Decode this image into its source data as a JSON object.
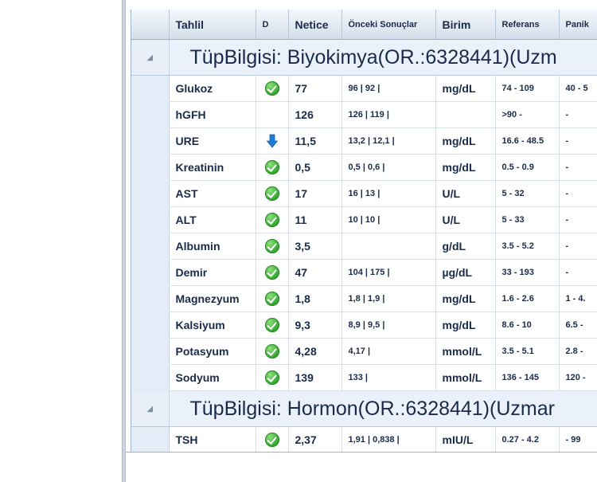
{
  "columns": {
    "tahlil": "Tahlil",
    "d": "D",
    "netice": "Netice",
    "onceki": "Önceki Sonuçlar",
    "birim": "Birim",
    "referans": "Referans",
    "panik": "Panik"
  },
  "groups": [
    {
      "title": "TüpBilgisi: Biyokimya(OR.:6328441)(Uzm",
      "rows": [
        {
          "name": "Glukoz",
          "status": "ok",
          "netice": "77",
          "onceki": "96 | 92 |",
          "birim": "mg/dL",
          "referans": "74 - 109",
          "panik": "40 - 5"
        },
        {
          "name": "hGFH",
          "status": "",
          "netice": "126",
          "onceki": "126 | 119 |",
          "birim": "",
          "referans": ">90 -",
          "panik": "-"
        },
        {
          "name": "URE",
          "status": "low",
          "netice": "11,5",
          "onceki": "13,2 | 12,1 |",
          "birim": "mg/dL",
          "referans": "16.6 - 48.5",
          "panik": "-"
        },
        {
          "name": "Kreatinin",
          "status": "ok",
          "netice": "0,5",
          "onceki": "0,5 | 0,6 |",
          "birim": "mg/dL",
          "referans": "0.5 - 0.9",
          "panik": "-"
        },
        {
          "name": "AST",
          "status": "ok",
          "netice": "17",
          "onceki": "16 | 13 |",
          "birim": "U/L",
          "referans": "5 - 32",
          "panik": "-"
        },
        {
          "name": "ALT",
          "status": "ok",
          "netice": "11",
          "onceki": "10 | 10 |",
          "birim": "U/L",
          "referans": "5 - 33",
          "panik": "-"
        },
        {
          "name": "Albumin",
          "status": "ok",
          "netice": "3,5",
          "onceki": "",
          "birim": "g/dL",
          "referans": "3.5 - 5.2",
          "panik": "-"
        },
        {
          "name": "Demir",
          "status": "ok",
          "netice": "47",
          "onceki": "104 | 175 |",
          "birim": "µg/dL",
          "referans": "33 - 193",
          "panik": "-"
        },
        {
          "name": "Magnezyum",
          "status": "ok",
          "netice": "1,8",
          "onceki": "1,8 | 1,9 |",
          "birim": "mg/dL",
          "referans": "1.6 - 2.6",
          "panik": "1 - 4."
        },
        {
          "name": "Kalsiyum",
          "status": "ok",
          "netice": "9,3",
          "onceki": "8,9 | 9,5 |",
          "birim": "mg/dL",
          "referans": "8.6 - 10",
          "panik": "6.5 -"
        },
        {
          "name": "Potasyum",
          "status": "ok",
          "netice": "4,28",
          "onceki": "4,17 |",
          "birim": "mmol/L",
          "referans": "3.5 - 5.1",
          "panik": "2.8 -"
        },
        {
          "name": "Sodyum",
          "status": "ok",
          "netice": "139",
          "onceki": "133 |",
          "birim": "mmol/L",
          "referans": "136 - 145",
          "panik": "120 -"
        }
      ]
    },
    {
      "title": "TüpBilgisi: Hormon(OR.:6328441)(Uzmar",
      "rows": [
        {
          "name": "TSH",
          "status": "ok",
          "netice": "2,37",
          "onceki": "1,91 | 0,838 |",
          "birim": "mIU/L",
          "referans": "0.27 - 4.2",
          "panik": "- 99"
        }
      ]
    }
  ],
  "icons": {
    "expander": "collapse-triangle-icon",
    "ok": "check-circle-icon",
    "low": "arrow-down-icon"
  },
  "colors": {
    "ok_green": "#3fb23a",
    "low_blue": "#1c7fd6",
    "header_text": "#1a2b49",
    "group_bg": "#e3ecf7"
  }
}
